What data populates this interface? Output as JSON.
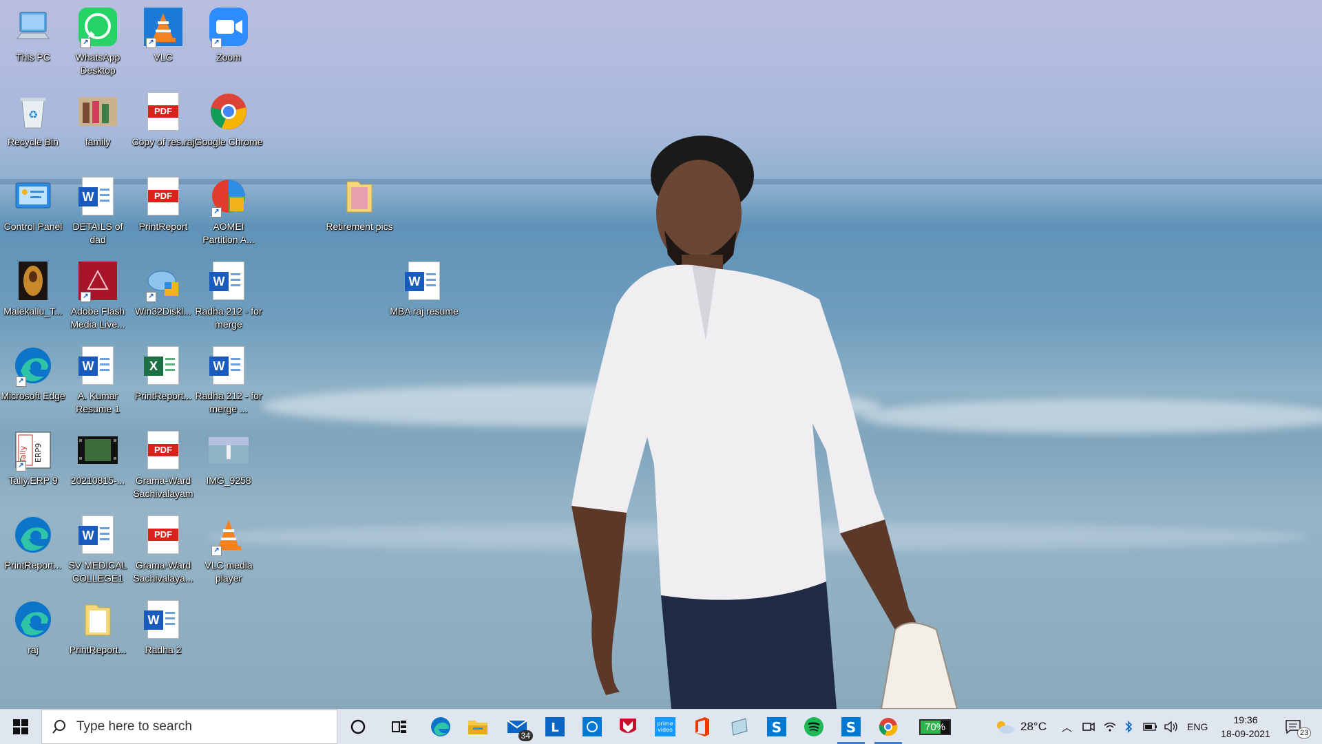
{
  "desktop": {
    "icons": [
      {
        "label": "This PC"
      },
      {
        "label": "WhatsApp Desktop"
      },
      {
        "label": "VLC"
      },
      {
        "label": "Zoom"
      },
      {
        "label": "Recycle Bin"
      },
      {
        "label": "family"
      },
      {
        "label": "Copy of res.raj"
      },
      {
        "label": "Google Chrome"
      },
      {
        "label": "Control Panel"
      },
      {
        "label": "DETAILS of dad"
      },
      {
        "label": "PrintReport"
      },
      {
        "label": "AOMEI Partition A..."
      },
      {
        "label": "Retirement pics"
      },
      {
        "label": "Malekallu_T..."
      },
      {
        "label": "Adobe Flash Media Live..."
      },
      {
        "label": "Win32Diskl..."
      },
      {
        "label": "Radha 212 - for merge"
      },
      {
        "label": "MBA raj resume"
      },
      {
        "label": "Microsoft Edge"
      },
      {
        "label": "A. Kumar Resume 1"
      },
      {
        "label": "PrintReport..."
      },
      {
        "label": "Radha 212 - for merge ..."
      },
      {
        "label": "Tally.ERP 9"
      },
      {
        "label": "20210815-..."
      },
      {
        "label": "Grama-Ward Sachivalayam"
      },
      {
        "label": "IMG_9258"
      },
      {
        "label": "PrintReport..."
      },
      {
        "label": "SV MEDICAL COLLEGE1"
      },
      {
        "label": "Grama-Ward Sachivalaya..."
      },
      {
        "label": "VLC media player"
      },
      {
        "label": "raj"
      },
      {
        "label": "PrintReport..."
      },
      {
        "label": "Radha 2"
      }
    ],
    "tally_icon_text": "Tally ERP9"
  },
  "taskbar": {
    "search_placeholder": "Type here to search",
    "mail_badge": "34",
    "battery_label": "70%",
    "weather_temp": "28°C",
    "language": "ENG",
    "time": "19:36",
    "date": "18-09-2021",
    "notification_count": "23",
    "pinned": [
      "Task View",
      "Microsoft Edge",
      "File Explorer",
      "Mail",
      "LinkedIn",
      "Cortana",
      "McAfee",
      "Prime Video",
      "Office",
      "Notes",
      "Skype",
      "Spotify",
      "Skype",
      "Google Chrome",
      "Battery Meter"
    ]
  },
  "colors": {
    "taskbar_bg": "#dfe6f0",
    "word_blue": "#185abd",
    "pdf_red": "#d9221c",
    "excel_green": "#1d7044",
    "active_indicator": "#3c7fd6"
  }
}
